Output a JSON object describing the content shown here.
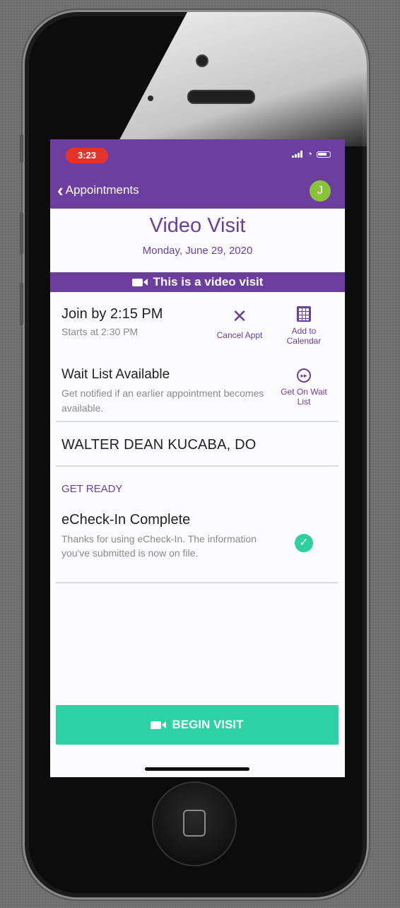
{
  "status_bar": {
    "time": "3:23"
  },
  "nav": {
    "back_label": "Appointments",
    "avatar_initial": "J"
  },
  "visit": {
    "title": "Video Visit",
    "date": "Monday, June 29, 2020",
    "banner": "This is a video visit",
    "join_by": "Join by 2:15 PM",
    "starts_at": "Starts at 2:30 PM",
    "provider": "WALTER DEAN KUCABA, DO"
  },
  "actions": {
    "cancel_label": "Cancel Appt",
    "calendar_label": "Add to Calendar",
    "waitlist_label": "Get On Wait List"
  },
  "waitlist": {
    "title": "Wait List Available",
    "desc": "Get notified if an earlier appointment becomes available."
  },
  "get_ready": {
    "section_label": "GET READY",
    "echeck_title": "eCheck-In Complete",
    "echeck_desc": "Thanks for using eCheck-In. The information you've submitted is now on file."
  },
  "begin_button": {
    "label": "BEGIN VISIT"
  },
  "colors": {
    "brand": "#6b3ea0",
    "accent": "#2cd3a2",
    "status_red": "#e7322a"
  }
}
